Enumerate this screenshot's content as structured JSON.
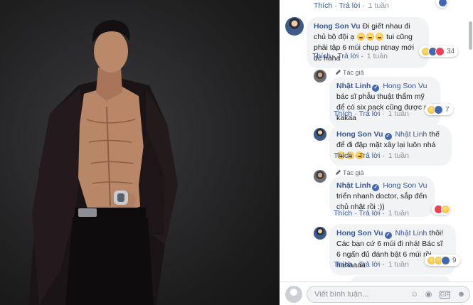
{
  "top_actions": {
    "like": "Thích",
    "reply": "Trả lời",
    "time": "1 tuần"
  },
  "author_badge": "Tác giả",
  "comments": [
    {
      "name": "Hong Son Vu",
      "text_before": "Đi giết nhau đi chủ bộ đội ạ",
      "text_after": "tui cũng phải tập 6 múi chụp ntnay mới dc haha",
      "like": "Thích",
      "reply": "Trả lời",
      "time": "1 tuần",
      "reaction_count": "34"
    },
    {
      "name": "Nhật Linh",
      "tag": "Hong Son Vu",
      "text": "bác sĩ phẫu thuật thẩm mỹ để có six pack cũng được nè kakaa",
      "like": "Thích",
      "reply": "Trả lời",
      "time": "1 tuần",
      "reaction_count": "7"
    },
    {
      "name": "Hong Son Vu",
      "tag": "Nhật Linh",
      "text": "thế để đi đập mặt xây lại luôn nhá",
      "like": "Thích",
      "reply": "Trả lời",
      "time": "1 tuần"
    },
    {
      "name": "Nhật Linh",
      "tag": "Hong Son Vu",
      "text": "triển nhanh doctor, sắp đến chủ nhật rồi :))",
      "like": "Thích",
      "reply": "Trả lời",
      "time": "1 tuần"
    },
    {
      "name": "Hong Son Vu",
      "tag": "Nhật Linh",
      "text": "thôi! Các bạn cứ 6 múi đi nhá! Bác sĩ 6 ngấn đủ đánh bật 6 múi rồi hahaaaa",
      "like": "Thích",
      "reply": "Trả lời",
      "time": "1 tuần",
      "reaction_count": "9"
    }
  ],
  "composer": {
    "placeholder": "Viết bình luận..."
  },
  "icons": [
    "pen-icon",
    "verified-icon",
    "emoji-icon",
    "camera-icon",
    "gif-icon",
    "sticker-icon",
    "haha-reaction-icon",
    "like-reaction-icon",
    "love-reaction-icon"
  ],
  "colors": {
    "link": "#385898",
    "bubble": "#f2f3f5",
    "meta": "#90949c",
    "like": "#4267b2",
    "love": "#f33e58"
  }
}
